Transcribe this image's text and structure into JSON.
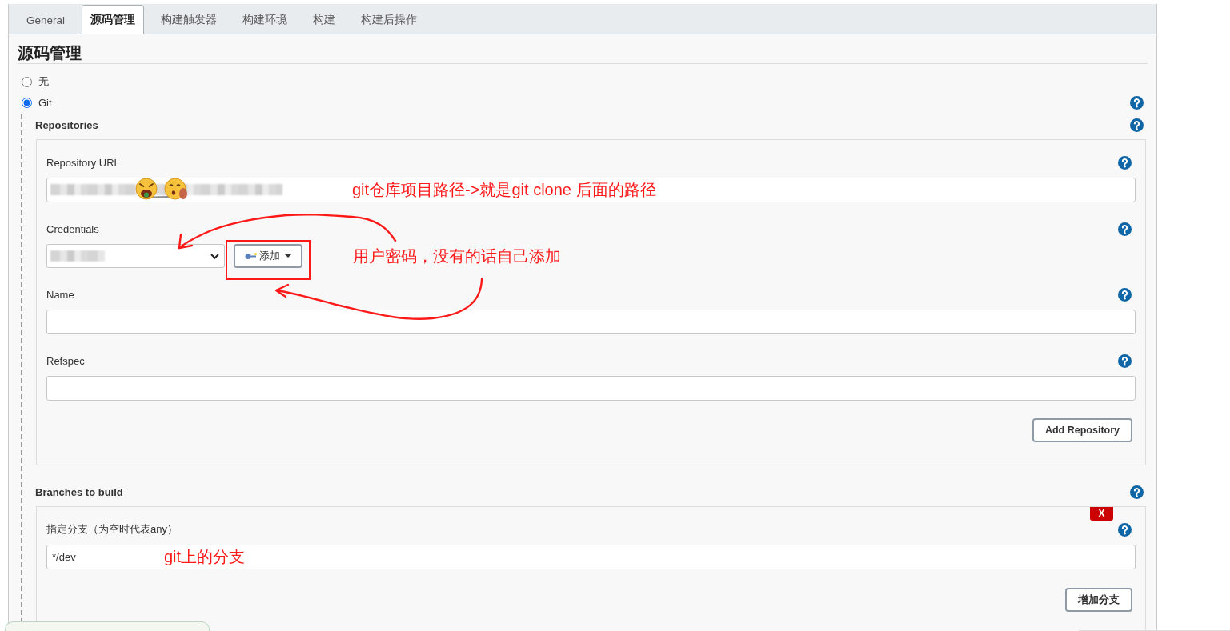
{
  "tabs": [
    {
      "label": "General",
      "selected": false
    },
    {
      "label": "源码管理",
      "selected": true
    },
    {
      "label": "构建触发器",
      "selected": false
    },
    {
      "label": "构建环境",
      "selected": false
    },
    {
      "label": "构建",
      "selected": false
    },
    {
      "label": "构建后操作",
      "selected": false
    }
  ],
  "section": {
    "title": "源码管理",
    "options": [
      {
        "label": "无",
        "selected": false,
        "help": false
      },
      {
        "label": "Git",
        "selected": true,
        "help": true
      }
    ]
  },
  "repositories": {
    "label": "Repositories",
    "fields": [
      {
        "kind": "text",
        "label": "Repository URL",
        "redacted": true,
        "note": "git仓库项目路径->就是git clone 后面的路径"
      },
      {
        "kind": "select",
        "label": "Credentials",
        "redacted": true,
        "add_button": "添加",
        "note": "用户密码，没有的话自己添加"
      },
      {
        "kind": "text",
        "label": "Name"
      },
      {
        "kind": "text",
        "label": "Refspec"
      }
    ],
    "add_button": "Add Repository"
  },
  "branches": {
    "label": "Branches to build",
    "items": [
      {
        "delete_button": "X",
        "label": "指定分支（为空时代表any）",
        "value": "*/dev",
        "note": "git上的分支"
      }
    ],
    "add_button": "增加分支"
  }
}
